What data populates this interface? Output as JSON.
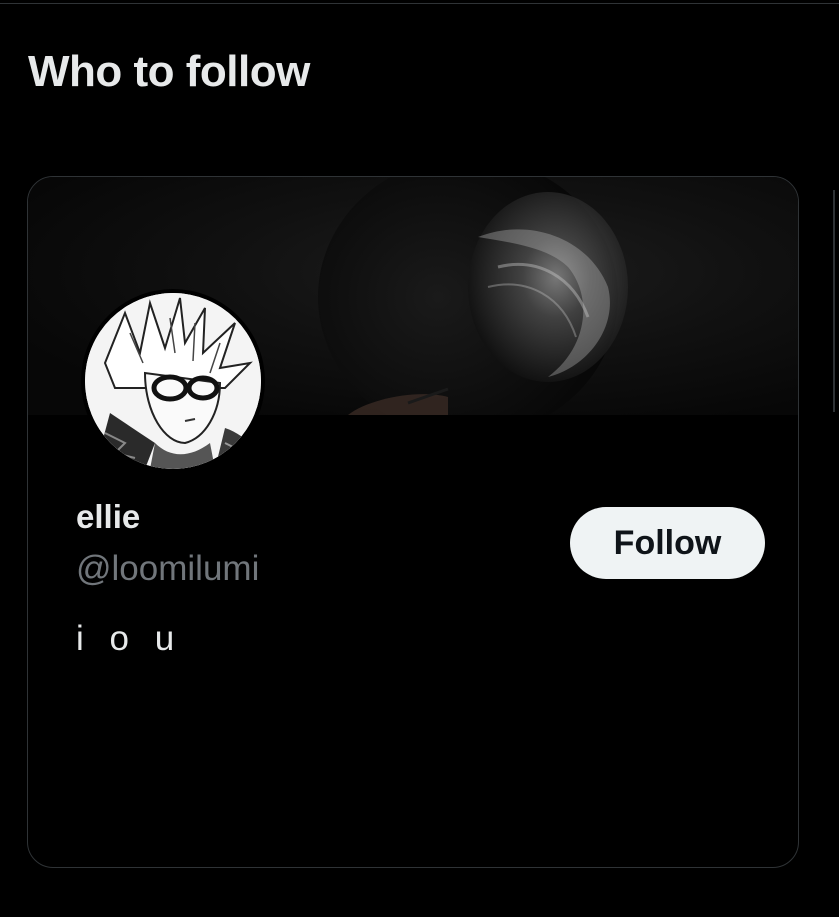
{
  "section": {
    "title": "Who to follow"
  },
  "card": {
    "display_name": "ellie",
    "handle": "@loomilumi",
    "bio": "i o u",
    "follow_label": "Follow"
  },
  "colors": {
    "background": "#000000",
    "primary_text": "#e7e9ea",
    "secondary_text": "#71767b",
    "border": "#2f3336",
    "follow_button_bg": "#eff3f4",
    "follow_button_text": "#0f1419"
  },
  "icons": {
    "avatar": "avatar-image",
    "banner": "profile-banner-image"
  }
}
